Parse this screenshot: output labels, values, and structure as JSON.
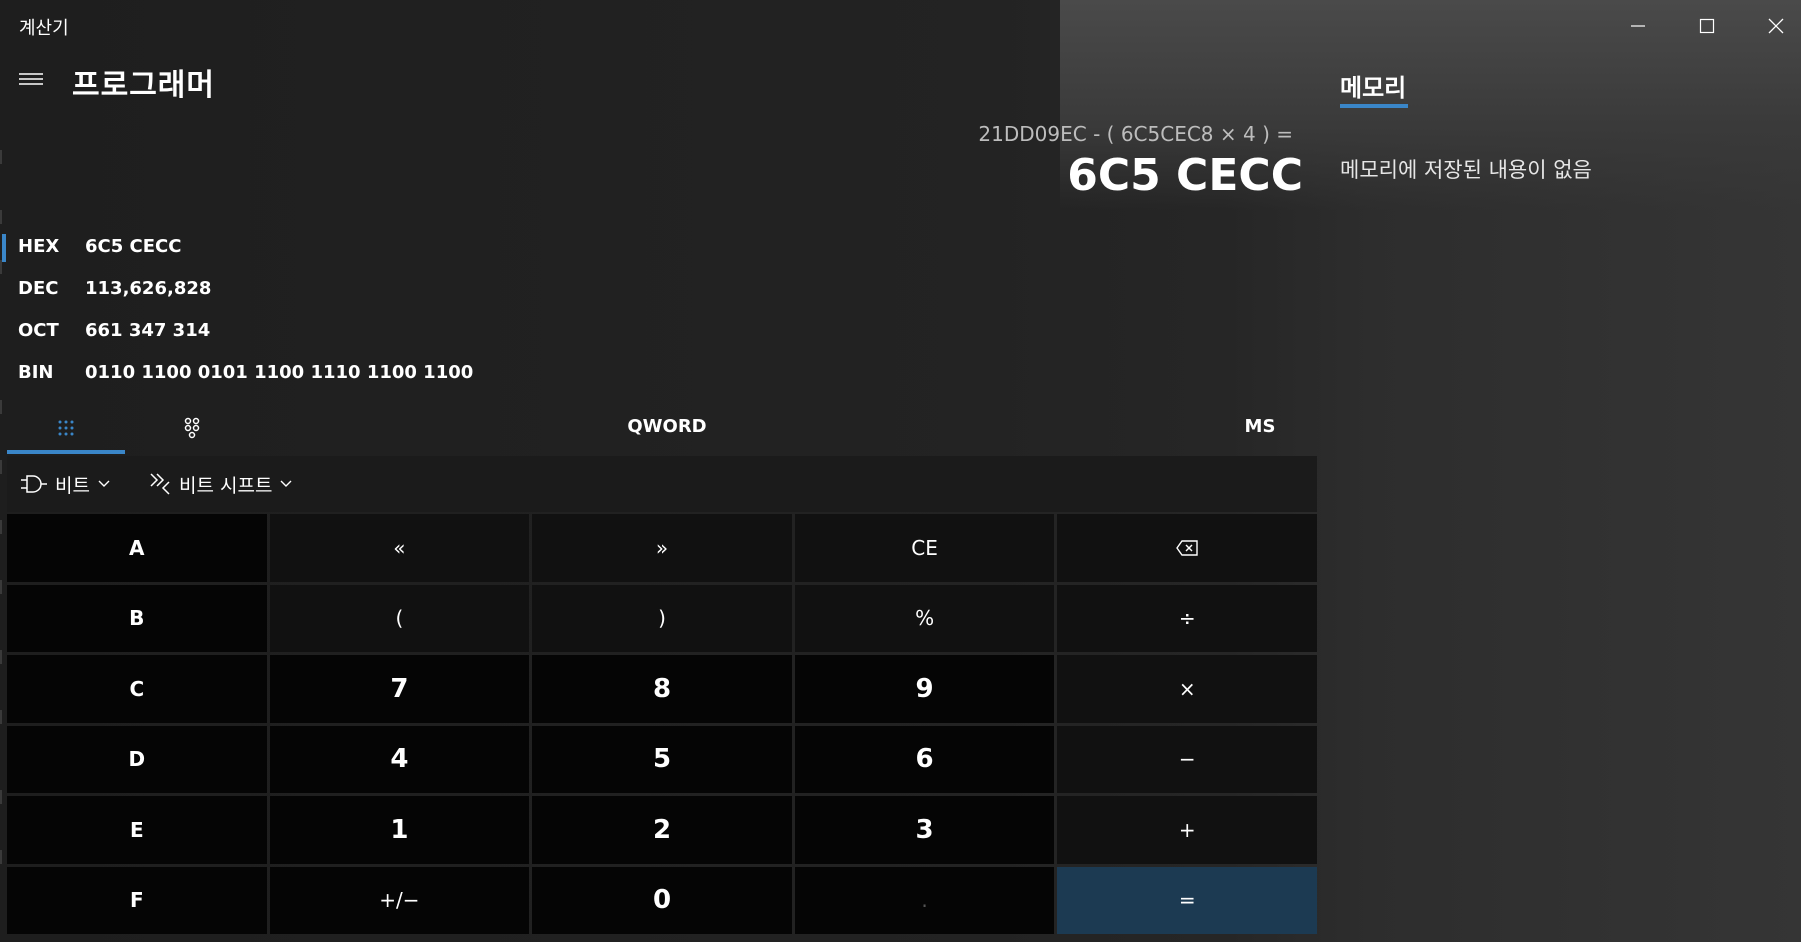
{
  "window": {
    "title": "계산기",
    "minimize_icon": "minimize-icon",
    "maximize_icon": "maximize-icon",
    "close_icon": "close-icon"
  },
  "header": {
    "menu_icon": "hamburger-icon",
    "mode": "프로그래머"
  },
  "display": {
    "expression": "21DD09EC - ( 6C5CEC8 × 4 ) =",
    "result": "6C5 CECC"
  },
  "radix": [
    {
      "name": "HEX",
      "value": "6C5 CECC",
      "selected": true
    },
    {
      "name": "DEC",
      "value": "113,626,828",
      "selected": false
    },
    {
      "name": "OCT",
      "value": "661 347 314",
      "selected": false
    },
    {
      "name": "BIN",
      "value": "0110 1100 0101 1100 1110 1100 1100",
      "selected": false
    }
  ],
  "mode_bar": {
    "keypad_tab_icon": "full-keypad-icon",
    "bit_toggle_tab_icon": "bit-toggle-keypad-icon",
    "word_size": "QWORD",
    "memory_store": "MS"
  },
  "bit_bar": {
    "bitwise": {
      "label": "비트",
      "icon": "logic-gate-icon"
    },
    "bitshift": {
      "label": "비트 시프트",
      "icon": "bit-shift-icon"
    }
  },
  "keys": {
    "row1": [
      "A",
      "«",
      "»",
      "CE",
      "⌫"
    ],
    "row2": [
      "B",
      "(",
      ")",
      "%",
      "÷"
    ],
    "row3": [
      "C",
      "7",
      "8",
      "9",
      "×"
    ],
    "row4": [
      "D",
      "4",
      "5",
      "6",
      "−"
    ],
    "row5": [
      "E",
      "1",
      "2",
      "3",
      "+"
    ],
    "row6": [
      "F",
      "+/−",
      "0",
      ".",
      "="
    ]
  },
  "memory": {
    "tab_label": "메모리",
    "empty_message": "메모리에 저장된 내용이 없음"
  },
  "colors": {
    "accent": "#3a86c8",
    "equals_key": "#1c3a52",
    "key_background": "#050505"
  }
}
